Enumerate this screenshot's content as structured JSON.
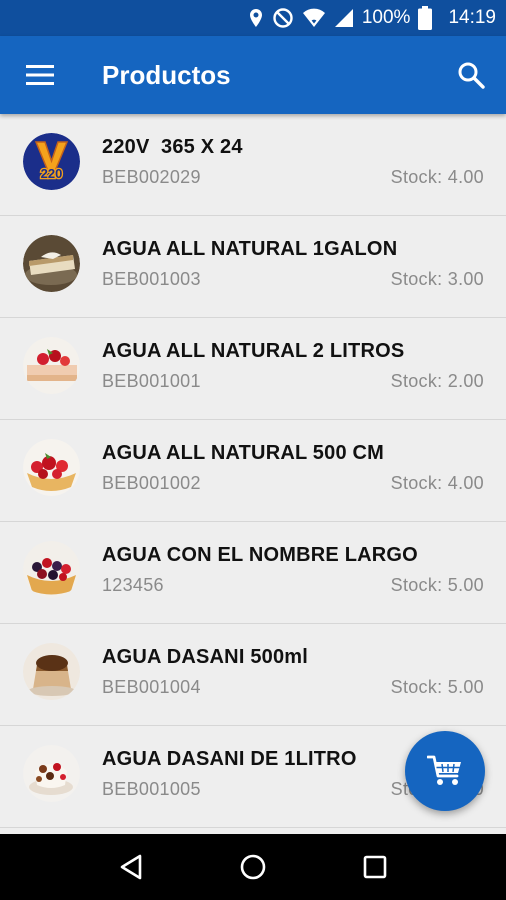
{
  "status_bar": {
    "battery_text": "100%",
    "time": "14:19"
  },
  "app_bar": {
    "title": "Productos",
    "menu_icon": "menu-icon",
    "search_icon": "search-icon"
  },
  "colors": {
    "primary": "#1565c0",
    "status_bar": "#0f4f9e",
    "background": "#eeeeee",
    "secondary_text": "#8a8a8a"
  },
  "products": [
    {
      "name": "220V  365 X 24",
      "code": "BEB002029",
      "stock": "Stock: 4.00",
      "image": "logo-v220"
    },
    {
      "name": "AGUA ALL NATURAL 1GALON",
      "code": "BEB001003",
      "stock": "Stock: 3.00",
      "image": "cake-slice"
    },
    {
      "name": "AGUA ALL NATURAL 2 LITROS",
      "code": "BEB001001",
      "stock": "Stock: 2.00",
      "image": "strawberry-cake"
    },
    {
      "name": "AGUA ALL NATURAL 500 CM",
      "code": "BEB001002",
      "stock": "Stock: 4.00",
      "image": "strawberry-tart"
    },
    {
      "name": "AGUA CON EL NOMBRE LARGO",
      "code": "123456",
      "stock": "Stock: 5.00",
      "image": "berry-tart"
    },
    {
      "name": "AGUA DASANI 500ml",
      "code": "BEB001004",
      "stock": "Stock: 5.00",
      "image": "chocolate-flan"
    },
    {
      "name": "AGUA DASANI DE 1LITRO",
      "code": "BEB001005",
      "stock": "Stock: 5.00",
      "image": "cream-dessert"
    }
  ],
  "fab": {
    "icon": "cart-icon"
  },
  "nav_bar": {
    "back_icon": "back-icon",
    "home_icon": "home-icon",
    "recents_icon": "recents-icon"
  }
}
